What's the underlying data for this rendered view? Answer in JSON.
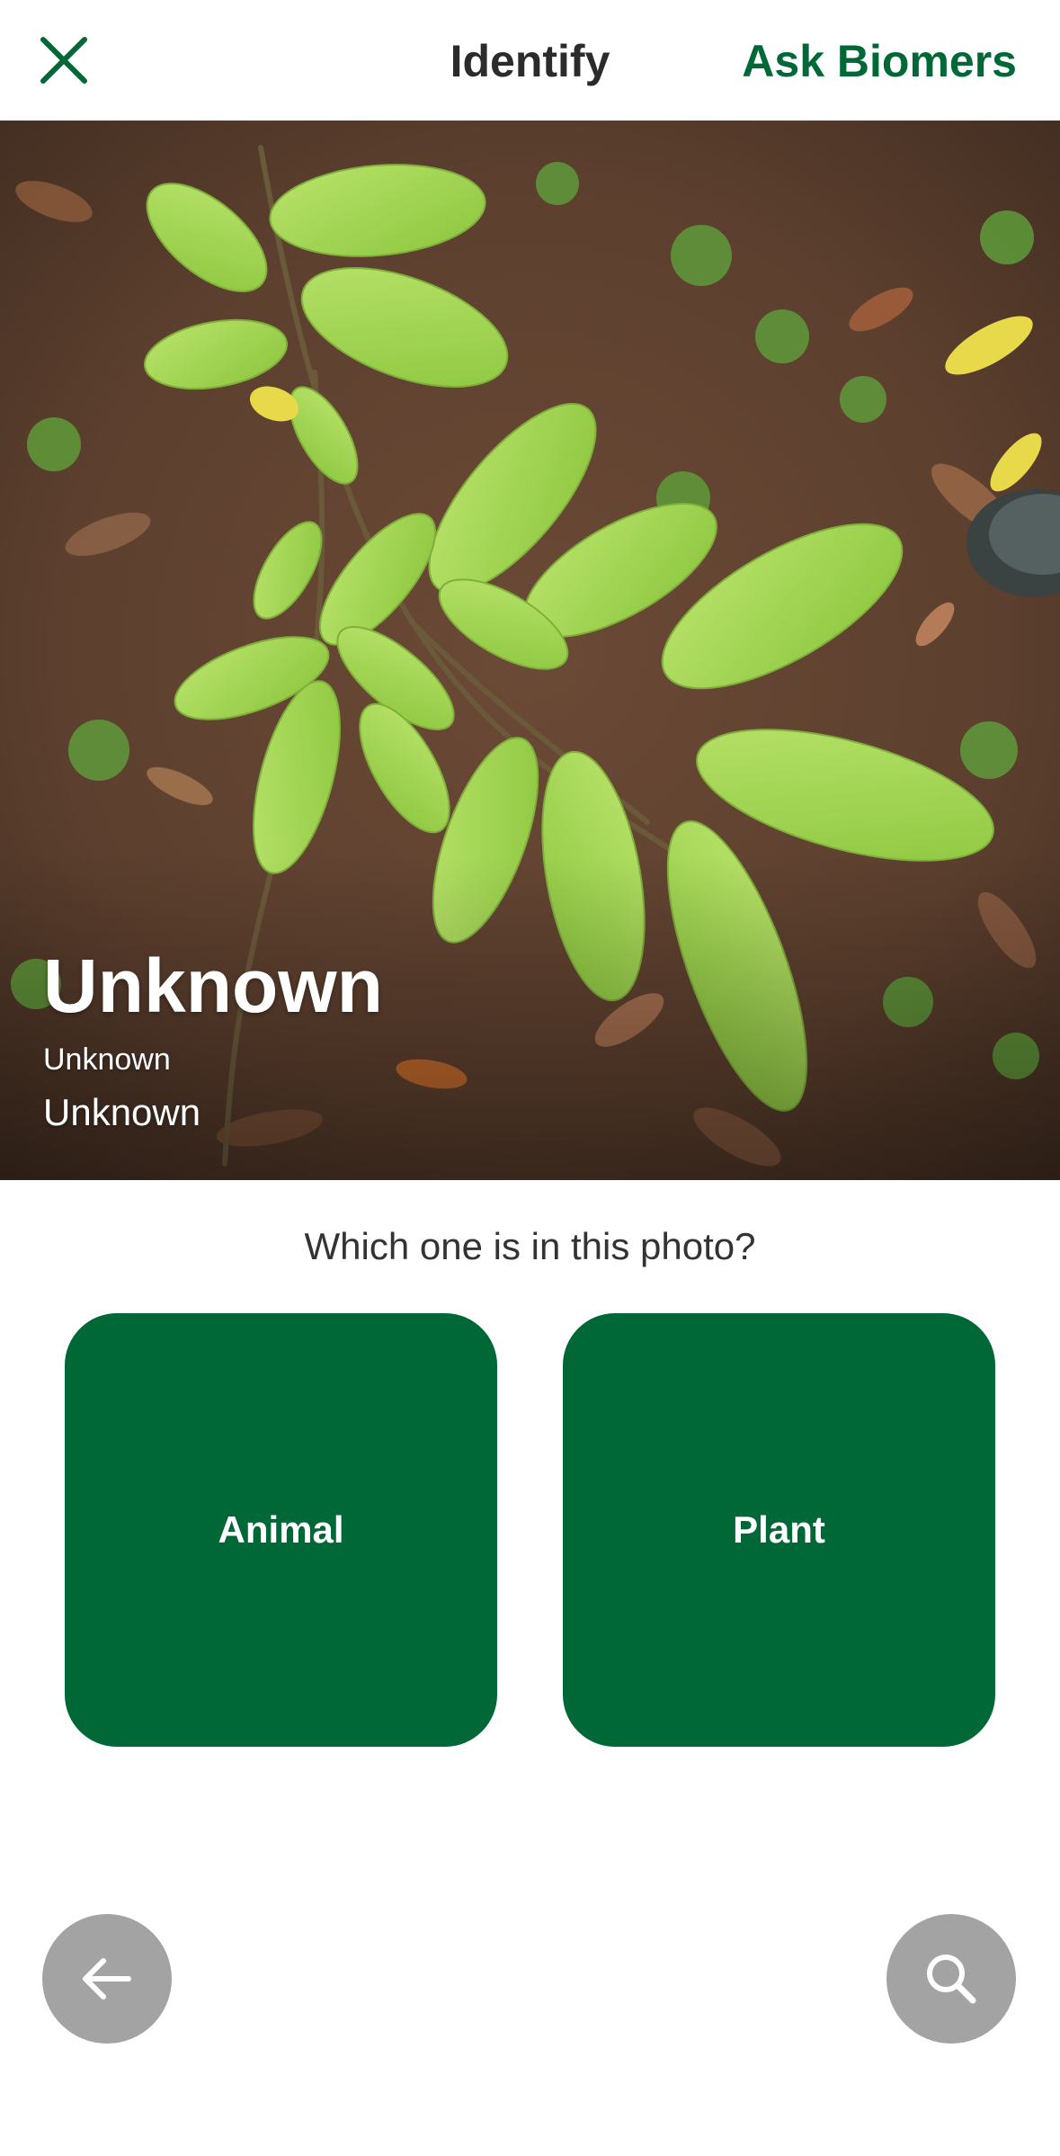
{
  "header": {
    "title": "Identify",
    "ask_label": "Ask Biomers",
    "close_icon": "close-icon",
    "accent_color": "#006837"
  },
  "photo": {
    "title": "Unknown",
    "subtitle_1": "Unknown",
    "subtitle_2": "Unknown"
  },
  "prompt": {
    "question": "Which one is in this photo?"
  },
  "choices": [
    {
      "label": "Animal"
    },
    {
      "label": "Plant"
    }
  ],
  "footer": {
    "back_icon": "arrow-left-icon",
    "search_icon": "search-icon",
    "button_color": "#a3a3a3"
  }
}
